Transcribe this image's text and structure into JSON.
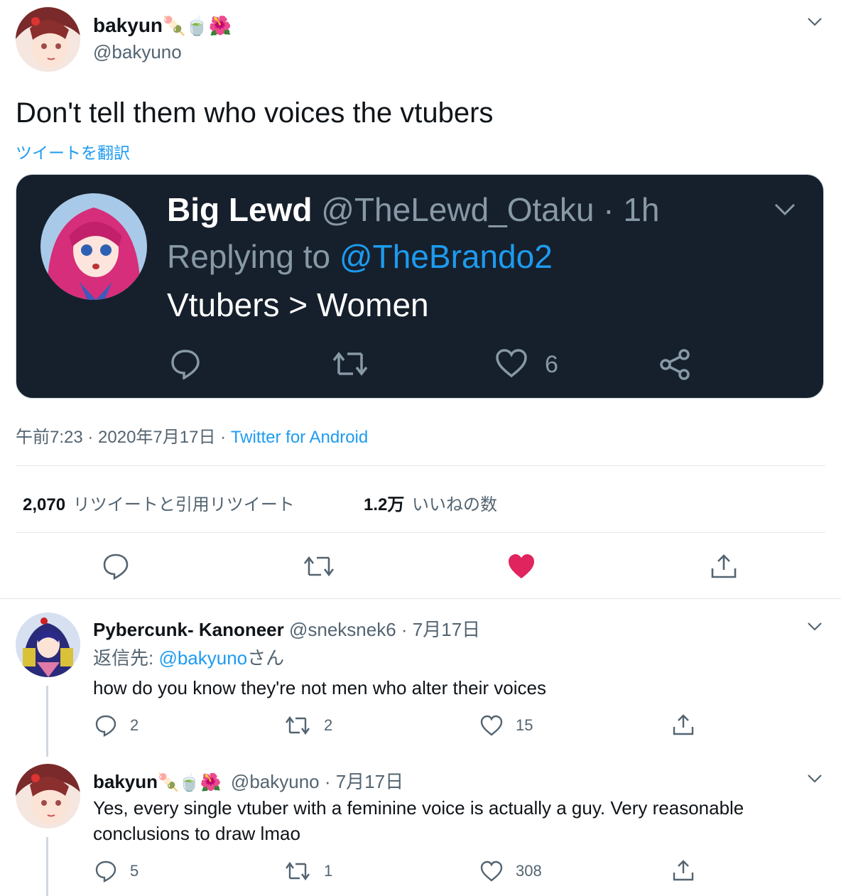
{
  "main_tweet": {
    "display_name": "bakyun",
    "emoji": "🍡🍵🌺",
    "handle": "@bakyuno",
    "text": "Don't tell them who voices the vtubers",
    "translate_link": "ツイートを翻訳",
    "embedded_image": {
      "name": "Big Lewd",
      "handle_time": "@TheLewd_Otaku · 1h",
      "replying_prefix": "Replying to ",
      "replying_to": "@TheBrando2",
      "text": "Vtubers > Women",
      "like_count": "6"
    },
    "timestamp": "午前7:23 · 2020年7月17日",
    "separator": " · ",
    "source": "Twitter for Android",
    "stats": {
      "retweets_count": "2,070",
      "retweets_label": "リツイートと引用リツイート",
      "likes_count": "1.2万",
      "likes_label": "いいねの数"
    },
    "liked": true
  },
  "replies": [
    {
      "display_name": "Pybercunk- Kanoneer",
      "handle_date": "@sneksnek6 · 7月17日",
      "reply_prefix": "返信先: ",
      "reply_to": "@bakyuno",
      "reply_suffix": "さん",
      "text": "how do you know they're not men who alter their voices",
      "counts": {
        "replies": "2",
        "retweets": "2",
        "likes": "15"
      }
    },
    {
      "display_name": "bakyun",
      "emoji": "🍡🍵🌺",
      "handle_date": "@bakyuno · 7月17日",
      "text_line1": "Yes, every single vtuber with a feminine voice is actually a guy. Very reasonable",
      "text_line2": "conclusions to draw lmao",
      "counts": {
        "replies": "5",
        "retweets": "1",
        "likes": "308"
      }
    }
  ],
  "colors": {
    "accent": "#1d9bf0",
    "like_red": "#e0245e",
    "dark_card": "#16202c",
    "muted": "#536471"
  }
}
